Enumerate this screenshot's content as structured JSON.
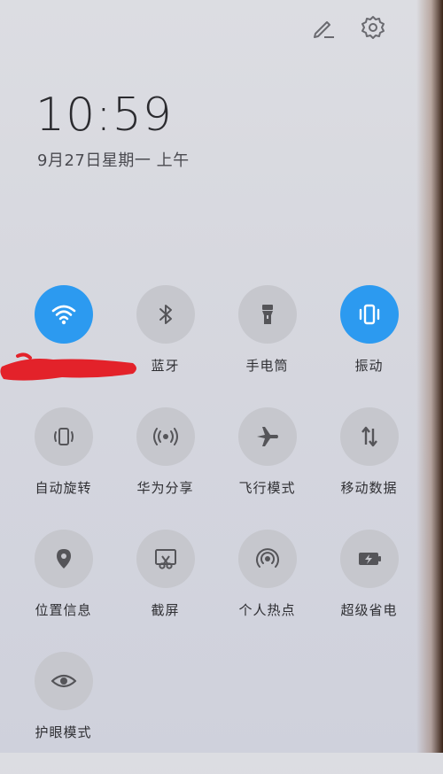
{
  "time": "10:59",
  "date": "9月27日星期一 上午",
  "header": {
    "edit_icon": "pencil-icon",
    "settings_icon": "gear-icon"
  },
  "accent_color": "#2c9af0",
  "tiles": [
    {
      "label": "",
      "icon": "wifi-icon",
      "active": true
    },
    {
      "label": "蓝牙",
      "icon": "bluetooth-icon",
      "active": false
    },
    {
      "label": "手电筒",
      "icon": "flashlight-icon",
      "active": false
    },
    {
      "label": "振动",
      "icon": "vibrate-icon",
      "active": true
    },
    {
      "label": "自动旋转",
      "icon": "auto-rotate-icon",
      "active": false
    },
    {
      "label": "华为分享",
      "icon": "huawei-share-icon",
      "active": false
    },
    {
      "label": "飞行模式",
      "icon": "airplane-icon",
      "active": false
    },
    {
      "label": "移动数据",
      "icon": "mobile-data-icon",
      "active": false
    },
    {
      "label": "位置信息",
      "icon": "location-icon",
      "active": false
    },
    {
      "label": "截屏",
      "icon": "screenshot-icon",
      "active": false
    },
    {
      "label": "个人热点",
      "icon": "hotspot-icon",
      "active": false
    },
    {
      "label": "超级省电",
      "icon": "battery-saver-icon",
      "active": false
    },
    {
      "label": "护眼模式",
      "icon": "eye-icon",
      "active": false
    }
  ]
}
